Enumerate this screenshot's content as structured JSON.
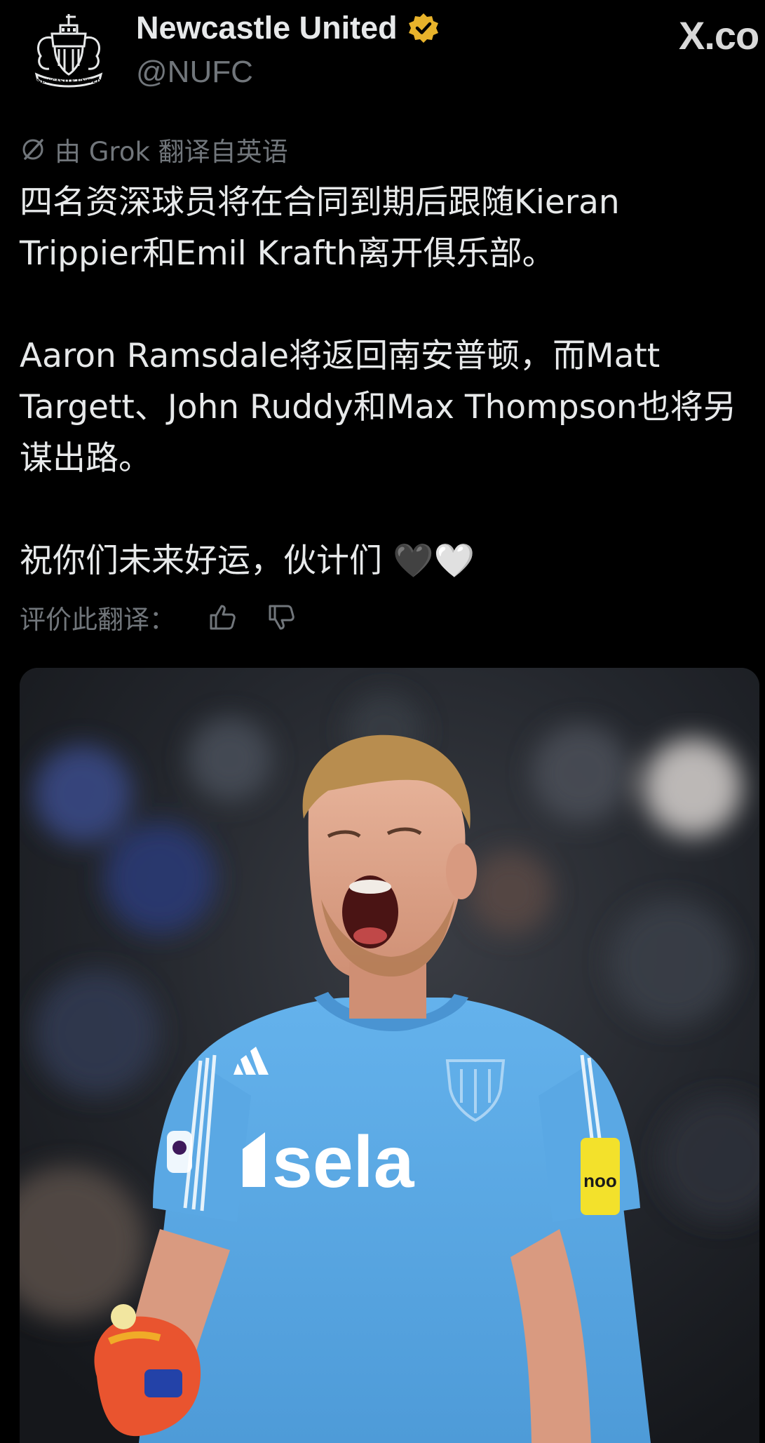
{
  "account": {
    "display_name": "Newcastle United",
    "handle": "@NUFC",
    "verified": true,
    "avatar_icon": "newcastle-crest-icon",
    "avatar_caption": "NEWCASTLE UNITED"
  },
  "platform": {
    "logo_text": "X.co"
  },
  "translation": {
    "note": "由 Grok 翻译自英语",
    "rate_label": "评价此翻译："
  },
  "tweet": {
    "paragraphs": [
      [
        "四名资深球员将在合同到期后跟随Kieran",
        "Trippier和Emil Krafth离开俱乐部。"
      ],
      [
        "Aaron Ramsdale将返回南安普顿，而Matt",
        "Targett、John Ruddy和Max Thompson也将另",
        "谋出路。"
      ],
      [
        "祝你们未来好运，伙计们 🖤🤍"
      ]
    ]
  },
  "media": {
    "sponsor_text": "sela",
    "sleeve_text": "noo"
  },
  "colors": {
    "background": "#000000",
    "text_primary": "#e7e9ea",
    "text_secondary": "#71767b",
    "verified_gold": "#e8b32b",
    "kit_blue": "#5aa8e4"
  }
}
